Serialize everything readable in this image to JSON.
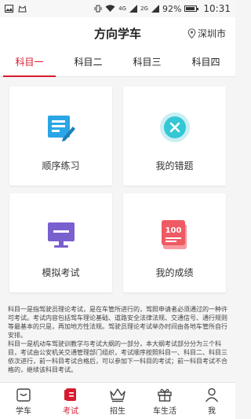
{
  "status_bar": {
    "network": "4G",
    "network2": "2G",
    "battery": "92%",
    "time": "10:31"
  },
  "header": {
    "title": "方向学车",
    "city": "深圳市"
  },
  "tabs": [
    {
      "label": "科目一"
    },
    {
      "label": "科目二"
    },
    {
      "label": "科目三"
    },
    {
      "label": "科目四"
    }
  ],
  "cards": [
    {
      "label": "顺序练习",
      "icon": "practice-notebook-icon"
    },
    {
      "label": "我的错题",
      "icon": "wrong-questions-icon"
    },
    {
      "label": "模拟考试",
      "icon": "mock-exam-monitor-icon"
    },
    {
      "label": "我的成绩",
      "icon": "score-100-icon",
      "badge": "100"
    }
  ],
  "description": [
    "科目一是指驾驶员理论考试，是在车管所进行的，驾照申请者必须通过的一种许可考试。考试内容包括驾车理论基础、道路安全法律法规、交通信号、通行规则等最基本的只是，再加地方性法规。驾驶员理论考试举办时间由各地车管所自行安排。",
    "科目一是机动车驾驶训教学与考试大纲的一部分，本大纲考试部分分为三个科目，考试由公安机关交通管理部门组织，考试顺序按照科目一、科目二、科目三依次进行，前一科目考试合格后，可以参加下一科目的考试；前一科目考试不合格的，继续该科目考试。"
  ],
  "bottom_nav": [
    {
      "label": "学车"
    },
    {
      "label": "考试"
    },
    {
      "label": "招生"
    },
    {
      "label": "车生活"
    },
    {
      "label": "我"
    }
  ],
  "colors": {
    "accent": "#d71b2f",
    "practice": "#2aa6e6",
    "wrong": "#34c7d6",
    "exam": "#7a5fce",
    "score": "#ef5a63"
  }
}
